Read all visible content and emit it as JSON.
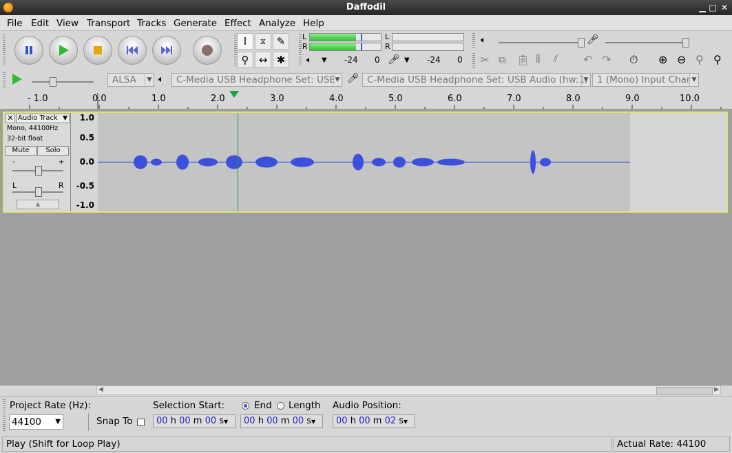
{
  "window": {
    "title": "Daffodil"
  },
  "menubar": {
    "items": [
      "File",
      "Edit",
      "View",
      "Transport",
      "Tracks",
      "Generate",
      "Effect",
      "Analyze",
      "Help"
    ]
  },
  "meters": {
    "playback_l": "L",
    "playback_r": "R",
    "record_l": "L",
    "record_r": "R",
    "scale_playback": [
      "-24",
      "0"
    ],
    "scale_record": [
      "-24",
      "0"
    ]
  },
  "device_toolbar": {
    "host": "ALSA",
    "playback_device": "C-Media USB Headphone Set: USE",
    "recording_device": "C-Media USB Headphone Set: USB Audio (hw:1,",
    "channels": "1 (Mono) Input Char"
  },
  "ruler": {
    "labels": [
      "- 1.0",
      "0.0",
      "1.0",
      "2.0",
      "3.0",
      "4.0",
      "5.0",
      "6.0",
      "7.0",
      "8.0",
      "9.0",
      "10.0"
    ]
  },
  "track": {
    "name": "Audio Track",
    "format_line1": "Mono, 44100Hz",
    "format_line2": "32-bit float",
    "mute": "Mute",
    "solo": "Solo",
    "gain_minus": "-",
    "gain_plus": "+",
    "pan_left": "L",
    "pan_right": "R",
    "vscale": [
      "1.0",
      "0.5",
      "0.0",
      "-0.5",
      "-1.0"
    ]
  },
  "selection_toolbar": {
    "project_rate_label": "Project Rate (Hz):",
    "project_rate": "44100",
    "snap_to": "Snap To",
    "selection_start_label": "Selection Start:",
    "end_label": "End",
    "length_label": "Length",
    "audio_position_label": "Audio Position:",
    "start_time": {
      "h": "00",
      "m": "00",
      "s": "00"
    },
    "end_time": {
      "h": "00",
      "m": "00",
      "s": "00"
    },
    "audio_position": {
      "h": "00",
      "m": "00",
      "s": "02"
    },
    "unit_h": "h",
    "unit_m": "m",
    "unit_s": "s"
  },
  "status": {
    "message": "Play (Shift for Loop Play)",
    "actual_rate": "Actual Rate: 44100"
  },
  "colors": {
    "waveform": "#3c50dc",
    "meter_green": "#44d044",
    "track_border": "#e2e27a",
    "playhead": "#20a040"
  }
}
